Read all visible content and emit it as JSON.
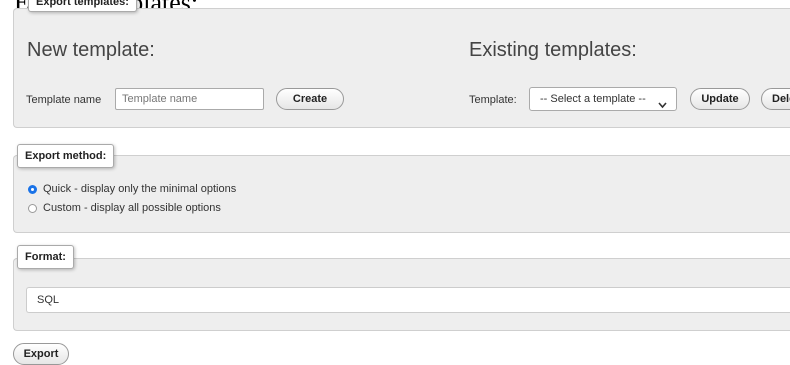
{
  "header": {
    "partial_text": "Export templates:"
  },
  "templates": {
    "legend": "Export templates:",
    "new": {
      "heading": "New template:",
      "name_label": "Template name",
      "name_placeholder": "Template name",
      "create_label": "Create"
    },
    "existing": {
      "heading": "Existing templates:",
      "template_label": "Template:",
      "select_value": "-- Select a template --",
      "update_label": "Update",
      "delete_label": "Delete"
    }
  },
  "export_method": {
    "legend": "Export method:",
    "options": [
      {
        "label": "Quick - display only the minimal options",
        "selected": true
      },
      {
        "label": "Custom - display all possible options",
        "selected": false
      }
    ]
  },
  "format": {
    "legend": "Format:",
    "value": "SQL"
  },
  "export_button": {
    "label": "Export"
  },
  "colors": {
    "radio_accent": "#1a73e8",
    "panel_bg": "#eeeeee"
  }
}
